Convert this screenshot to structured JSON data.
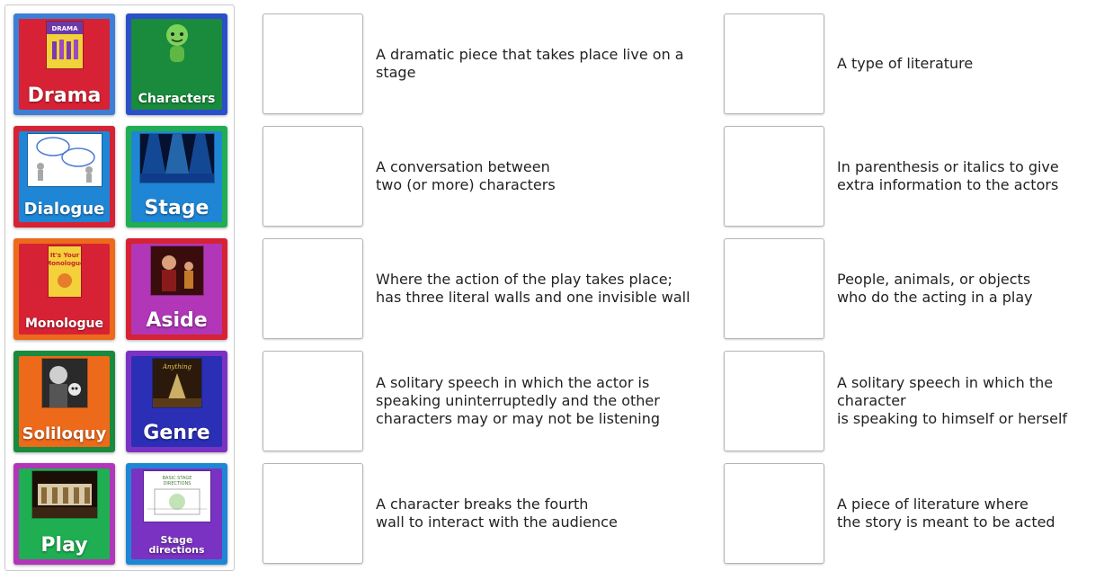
{
  "tiles": [
    {
      "label": "Drama",
      "outer": "#3d7fd6",
      "inner": "#d62234",
      "icon": "drama-book-cover-icon"
    },
    {
      "label": "Characters",
      "outer": "#2a4fc9",
      "inner": "#1a8a3c",
      "icon": "cartoon-character-icon"
    },
    {
      "label": "Dialogue",
      "outer": "#d62234",
      "inner": "#1f86d6",
      "icon": "speech-bubbles-icon"
    },
    {
      "label": "Stage",
      "outer": "#1fae52",
      "inner": "#1f86d6",
      "icon": "stage-lights-icon"
    },
    {
      "label": "Monologue",
      "outer": "#ee6a1b",
      "inner": "#d62234",
      "icon": "monologue-book-cover-icon"
    },
    {
      "label": "Aside",
      "outer": "#d62234",
      "inner": "#b137b8",
      "icon": "actors-on-stage-icon"
    },
    {
      "label": "Soliloquy",
      "outer": "#1a8a3c",
      "inner": "#ee6a1b",
      "icon": "actor-with-skull-icon"
    },
    {
      "label": "Genre",
      "outer": "#7a32c2",
      "inner": "#2a2fb5",
      "icon": "genre-poster-icon"
    },
    {
      "label": "Play",
      "outer": "#b137b8",
      "inner": "#1fae52",
      "icon": "theatre-stage-icon"
    },
    {
      "label": "Stage\ndirections",
      "outer": "#1f86d6",
      "inner": "#7a32c2",
      "icon": "stage-diagram-icon"
    }
  ],
  "clues_left": [
    "A dramatic piece that takes place live on a stage",
    "A conversation between\ntwo (or more) characters",
    "Where the action of the play takes place;\nhas three literal walls and one invisible wall",
    "A solitary speech in which the actor is\nspeaking uninterruptedly and the other\ncharacters may or may not be listening",
    "A character breaks the fourth\nwall to interact with the audience"
  ],
  "clues_right": [
    "A type of literature",
    "In parenthesis or italics to give\nextra information to the actors",
    "People, animals, or objects\nwho do the acting in a play",
    "A solitary speech in which the character\nis speaking to himself or herself",
    "A piece of literature where\nthe story is meant to be acted"
  ]
}
